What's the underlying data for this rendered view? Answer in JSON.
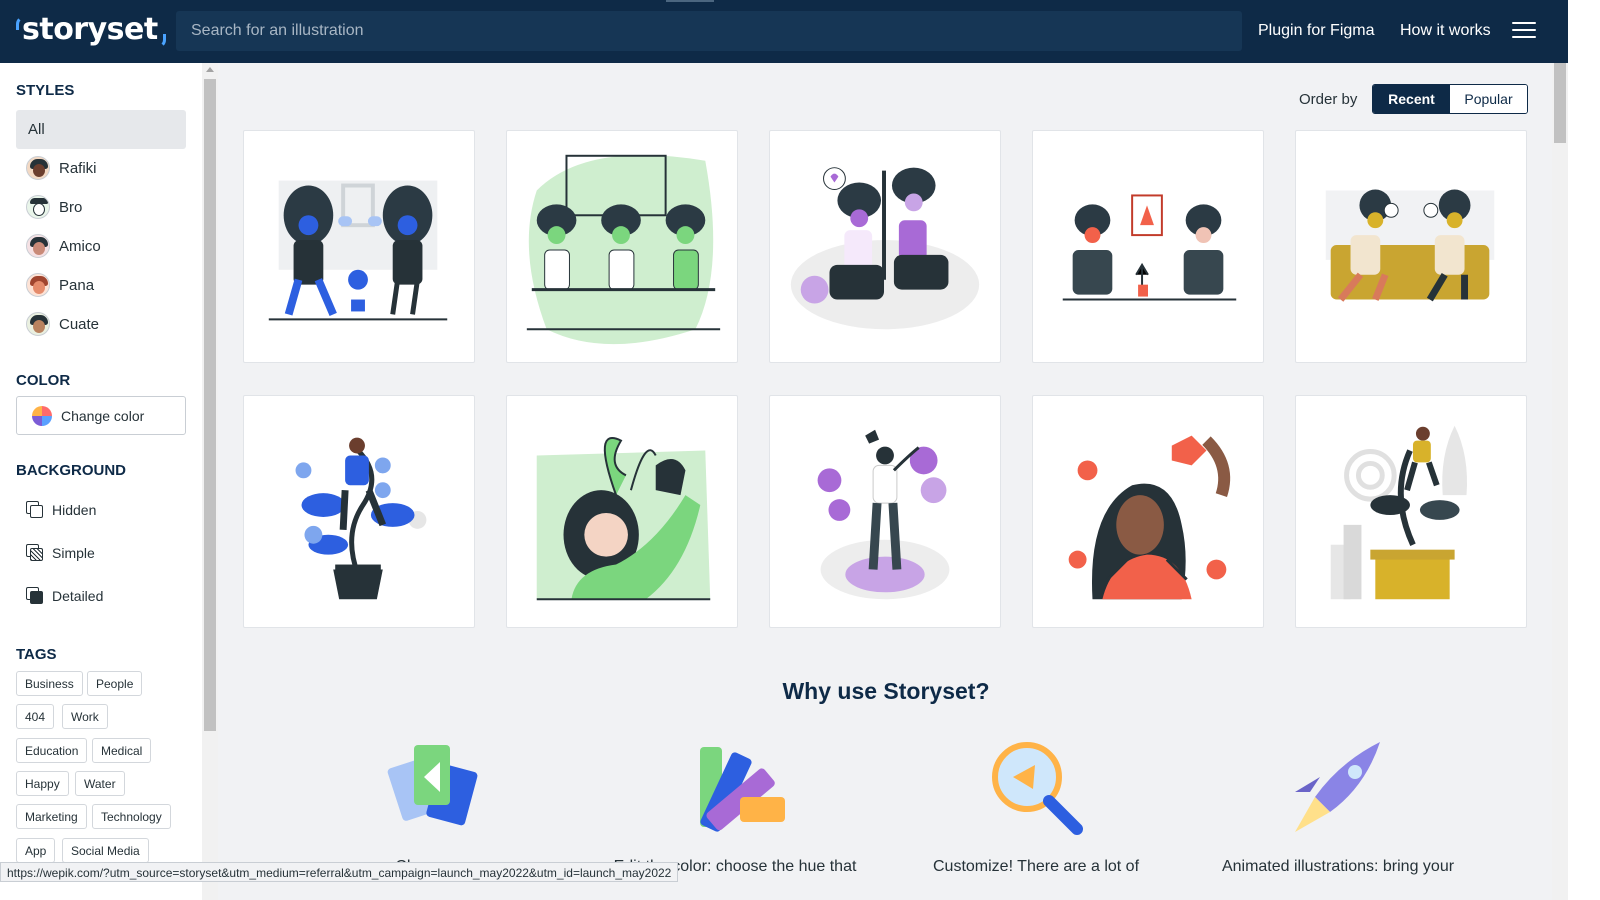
{
  "header": {
    "logo_text": "storyset",
    "search_placeholder": "Search for an illustration",
    "plugin_link": "Plugin for Figma",
    "how_link": "How it works"
  },
  "sidebar": {
    "styles_title": "STYLES",
    "styles": [
      {
        "label": "All"
      },
      {
        "label": "Rafiki"
      },
      {
        "label": "Bro"
      },
      {
        "label": "Amico"
      },
      {
        "label": "Pana"
      },
      {
        "label": "Cuate"
      }
    ],
    "color_title": "COLOR",
    "change_color": "Change color",
    "background_title": "BACKGROUND",
    "backgrounds": [
      {
        "label": "Hidden"
      },
      {
        "label": "Simple"
      },
      {
        "label": "Detailed"
      }
    ],
    "tags_title": "TAGS",
    "tags": [
      "Business",
      "People",
      "404",
      "Work",
      "Education",
      "Medical",
      "Happy",
      "Water",
      "Marketing",
      "Technology",
      "App",
      "Social Media"
    ]
  },
  "order": {
    "label": "Order by",
    "recent": "Recent",
    "popular": "Popular"
  },
  "why": {
    "title": "Why use Storyset?",
    "features": [
      {
        "icon": "layers-icon",
        "text": "Change..."
      },
      {
        "icon": "color-palette-icon",
        "text": "Edit the color: choose the hue that"
      },
      {
        "icon": "magnifier-icon",
        "text": "Customize! There are a lot of"
      },
      {
        "icon": "rocket-icon",
        "text": "Animated illustrations: bring your"
      }
    ]
  },
  "status_url": "https://wepik.com/?utm_source=storyset&utm_medium=referral&utm_campaign=launch_may2022&utm_id=launch_may2022",
  "colors": {
    "header_bg": "#0e2a47",
    "accent_blue": "#2d5fe0",
    "accent_green": "#7bd67e",
    "accent_purple": "#a86ad6",
    "accent_red": "#f2614a",
    "accent_yellow": "#d8b22a"
  }
}
